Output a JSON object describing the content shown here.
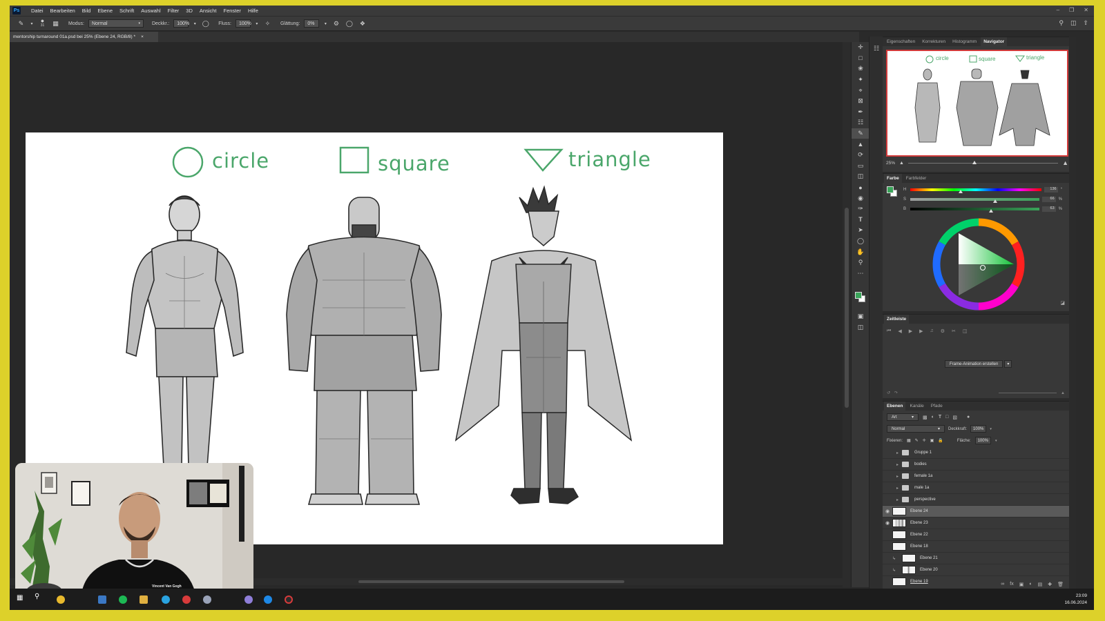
{
  "menubar": {
    "logo": "Ps",
    "items": [
      "Datei",
      "Bearbeiten",
      "Bild",
      "Ebene",
      "Schrift",
      "Auswahl",
      "Filter",
      "3D",
      "Ansicht",
      "Fenster",
      "Hilfe"
    ]
  },
  "options_bar": {
    "mode_label": "Modus:",
    "mode_value": "Normal",
    "opacity_label": "Deckkr.:",
    "opacity_value": "100%",
    "flow_label": "Fluss:",
    "flow_value": "100%",
    "smoothing_label": "Glättung:",
    "smoothing_value": "0%",
    "brush_size": "31"
  },
  "document_tab": {
    "title": "mentorship turnaround 01a.psd bei 25% (Ebene 24, RGB/8) *",
    "close": "×"
  },
  "artwork": {
    "labels": [
      "circle",
      "square",
      "triangle"
    ],
    "accent_color": "#4aa66a"
  },
  "panels": {
    "top_tabs": [
      "Eigenschaften",
      "Korrekturen",
      "Histogramm",
      "Navigator"
    ],
    "active_top_tab": "Navigator",
    "zoom_value": "25%",
    "color_tabs": [
      "Farbe",
      "Farbfelder"
    ],
    "hsb_values": [
      "136",
      "66",
      "63"
    ],
    "hsb_units": [
      "°",
      "%",
      "%"
    ],
    "foreground_color": "#3aa55a",
    "timeline_title": "Zeitleiste",
    "timeline_button": "Frame-Animation erstellen",
    "layers_tabs": [
      "Ebenen",
      "Kanäle",
      "Pfade"
    ],
    "filter_kind": "Art",
    "blend_mode": "Normal",
    "opacity_label": "Deckkraft:",
    "opacity_value": "100%",
    "lock_label": "Fixieren:",
    "fill_label": "Fläche:",
    "fill_value": "100%",
    "layers": [
      {
        "name": "Gruppe 1",
        "type": "group",
        "visible": false
      },
      {
        "name": "bodies",
        "type": "group",
        "visible": false
      },
      {
        "name": "female 1a",
        "type": "group",
        "visible": false
      },
      {
        "name": "male 1a",
        "type": "group",
        "visible": false
      },
      {
        "name": "perspective",
        "type": "group",
        "visible": false
      },
      {
        "name": "Ebene 24",
        "type": "layer",
        "visible": true,
        "selected": true
      },
      {
        "name": "Ebene 23",
        "type": "layer",
        "visible": true
      },
      {
        "name": "Ebene 22",
        "type": "layer",
        "visible": false
      },
      {
        "name": "Ebene 18",
        "type": "layer",
        "visible": false
      },
      {
        "name": "Ebene 21",
        "type": "layer",
        "visible": false
      },
      {
        "name": "Ebene 20",
        "type": "layer",
        "visible": false
      },
      {
        "name": "Ebene 19",
        "type": "layer",
        "visible": false
      }
    ]
  },
  "taskbar": {
    "time": "23:09",
    "date": "16.06.2024"
  },
  "webcam": {
    "shirt_text": "Vincent Van Gogh"
  }
}
